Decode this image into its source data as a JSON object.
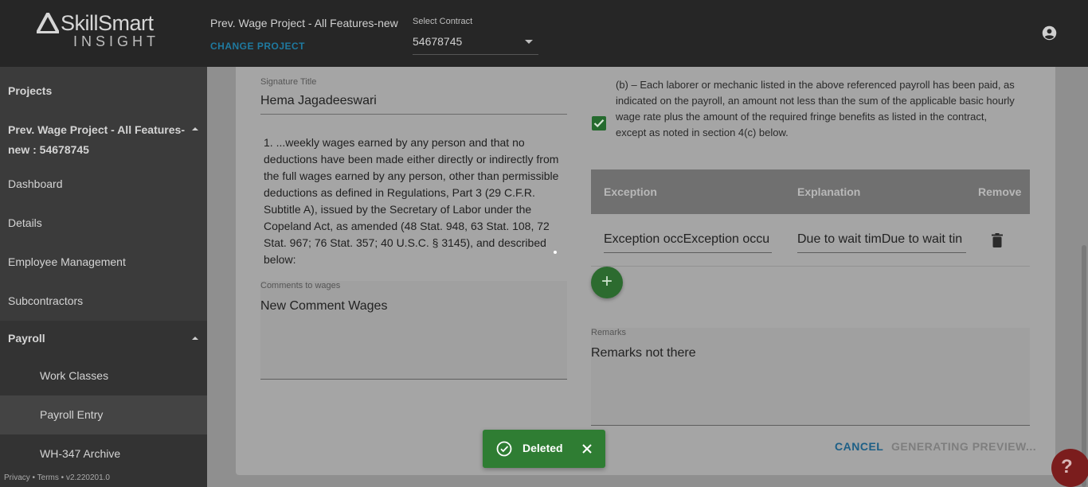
{
  "header": {
    "brand": "SkillSmart",
    "brand_sub": "INSIGHT",
    "project_title": "Prev. Wage Project - All Features-new",
    "change_project": "CHANGE PROJECT",
    "select_contract_label": "Select Contract",
    "contract_value": "54678745",
    "account_icon": "account-circle-icon"
  },
  "sidebar": {
    "projects": "Projects",
    "current_project_line1": "Prev. Wage Project - All Features-",
    "current_project_line2": "new : 54678745",
    "items": [
      "Dashboard",
      "Details",
      "Employee Management",
      "Subcontractors"
    ],
    "payroll": "Payroll",
    "payroll_items": [
      "Work Classes",
      "Payroll Entry",
      "WH-347 Archive"
    ],
    "active_item": "Payroll Entry",
    "footer": "Privacy • Terms • v2.220201.0"
  },
  "form": {
    "signature_title_label": "Signature Title",
    "signature_title_value": "Hema Jagadeeswari",
    "wages_statement": "1. ...weekly wages earned by any person and that no deductions have been made either directly or indirectly from the full wages earned by any person, other than permissible deductions as defined in Regulations, Part 3 (29 C.F.R. Subtitle A), issued by the Secretary of Labor under the Copeland Act, as amended (48 Stat. 948, 63 Stat. 108, 72 Stat. 967; 76 Stat. 357; 40 U.S.C. § 3145), and described below:",
    "comments_label": "Comments to wages",
    "comments_value": "New Comment Wages",
    "b_checked": true,
    "b_statement": "(b) – Each laborer or mechanic listed in the above referenced payroll has been paid, as indicated on the payroll, an amount not less than the sum of the applicable basic hourly wage rate plus the amount of the required fringe benefits as listed in the contract, except as noted in section 4(c) below.",
    "exceptions": {
      "columns": [
        "Exception",
        "Explanation",
        "Remove"
      ],
      "rows": [
        {
          "exception": "Exception occException occu",
          "explanation": "Due to wait timDue to wait tin"
        }
      ]
    },
    "remarks_label": "Remarks",
    "remarks_value": "Remarks not there",
    "cancel": "CANCEL",
    "generating": "GENERATING PREVIEW..."
  },
  "toast": {
    "message": "Deleted",
    "icon": "check-circle-icon",
    "color": "#2f7d33"
  },
  "help": {
    "label": "?"
  },
  "colors": {
    "topbar": "#262626",
    "sidebar": "#3b3b3b",
    "accent_link": "#1f7aa0",
    "success": "#2c6b2f",
    "help": "#7b1d1d"
  }
}
